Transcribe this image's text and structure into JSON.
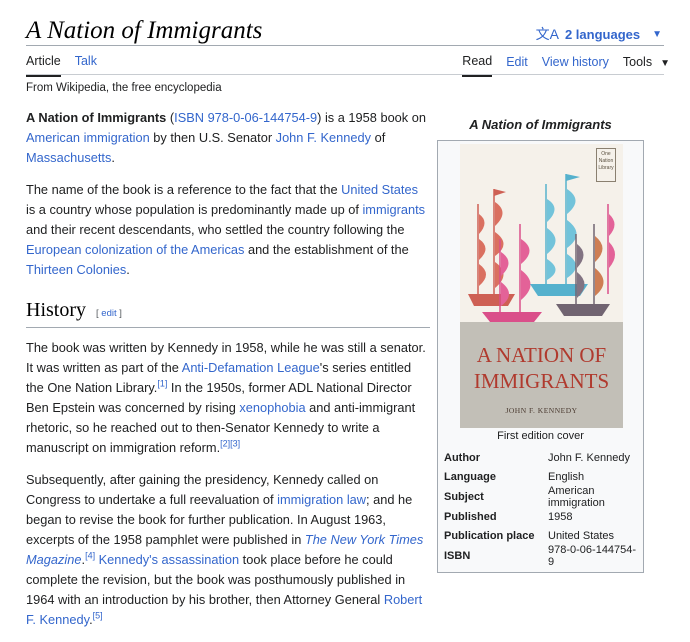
{
  "header": {
    "title": "A Nation of Immigrants",
    "languages_label": "2 languages",
    "tabs_left": [
      "Article",
      "Talk"
    ],
    "tabs_right": [
      "Read",
      "Edit",
      "View history"
    ],
    "tools_label": "Tools",
    "from": "From Wikipedia, the free encyclopedia"
  },
  "intro": {
    "p1": {
      "t1": "A Nation of Immigrants",
      "t2": " (",
      "isbn": "ISBN 978-0-06-144754-9",
      "t3": ") is a 1958 book on ",
      "l1": "American immigration",
      "t4": " by then U.S. Senator ",
      "l2": "John F. Kennedy",
      "t5": " of ",
      "l3": "Massachusetts",
      "t6": "."
    },
    "p2": {
      "t1": "The name of the book is a reference to the fact that the ",
      "l1": "United States",
      "t2": " is a country whose population is predominantly made up of ",
      "l2": "immigrants",
      "t3": " and their recent descendants, who settled the country following the ",
      "l3": "European colonization of the Americas",
      "t4": " and the establishment of the ",
      "l4": "Thirteen Colonies",
      "t5": "."
    }
  },
  "history": {
    "heading": "History",
    "edit_open": "[ ",
    "edit_label": "edit",
    "edit_close": " ]",
    "p1": {
      "t1": "The book was written by Kennedy in 1958, while he was still a senator. It was written as part of the ",
      "l1": "Anti-Defamation League",
      "t2": "'s series entitled the One Nation Library.",
      "r1": "[1]",
      "t3": " In the 1950s, former ADL National Director Ben Epstein was concerned by rising ",
      "l2": "xenophobia",
      "t4": " and anti-immigrant rhetoric, so he reached out to then-Senator Kennedy to write a manuscript on immigration reform.",
      "r2": "[2]",
      "r3": "[3]"
    },
    "p2": {
      "t1": "Subsequently, after gaining the presidency, Kennedy called on Congress to undertake a full reevaluation of ",
      "l1": "immigration law",
      "t2": "; and he began to revise the book for further publication. In August 1963, excerpts of the 1958 pamphlet were published in ",
      "l2": "The New York Times Magazine",
      "t3": ".",
      "r1": "[4]",
      "t4": " ",
      "l3": "Kennedy's assassination",
      "t5": " took place before he could complete the revision, but the book was posthumously published in 1964 with an introduction by his brother, then Attorney General ",
      "l4": "Robert F. Kennedy",
      "t6": ".",
      "r2": "[5]"
    }
  },
  "infobox": {
    "title": "A Nation of Immigrants",
    "cover": {
      "title_line1": "A NATION OF",
      "title_line2": "IMMIGRANTS",
      "author": "JOHN F. KENNEDY",
      "tag": "One Nation Library"
    },
    "caption": "First edition cover",
    "rows": [
      {
        "label": "Author",
        "value": "John F. Kennedy"
      },
      {
        "label": "Language",
        "value": "English"
      },
      {
        "label": "Subject",
        "value": "American immigration"
      },
      {
        "label": "Published",
        "value": "1958"
      },
      {
        "label": "Publication place",
        "value": "United States"
      },
      {
        "label": "ISBN",
        "value": "978-0-06-144754-9"
      }
    ]
  },
  "colors": {
    "link": "#3366cc",
    "text": "#202122",
    "border": "#a2a9b1"
  }
}
